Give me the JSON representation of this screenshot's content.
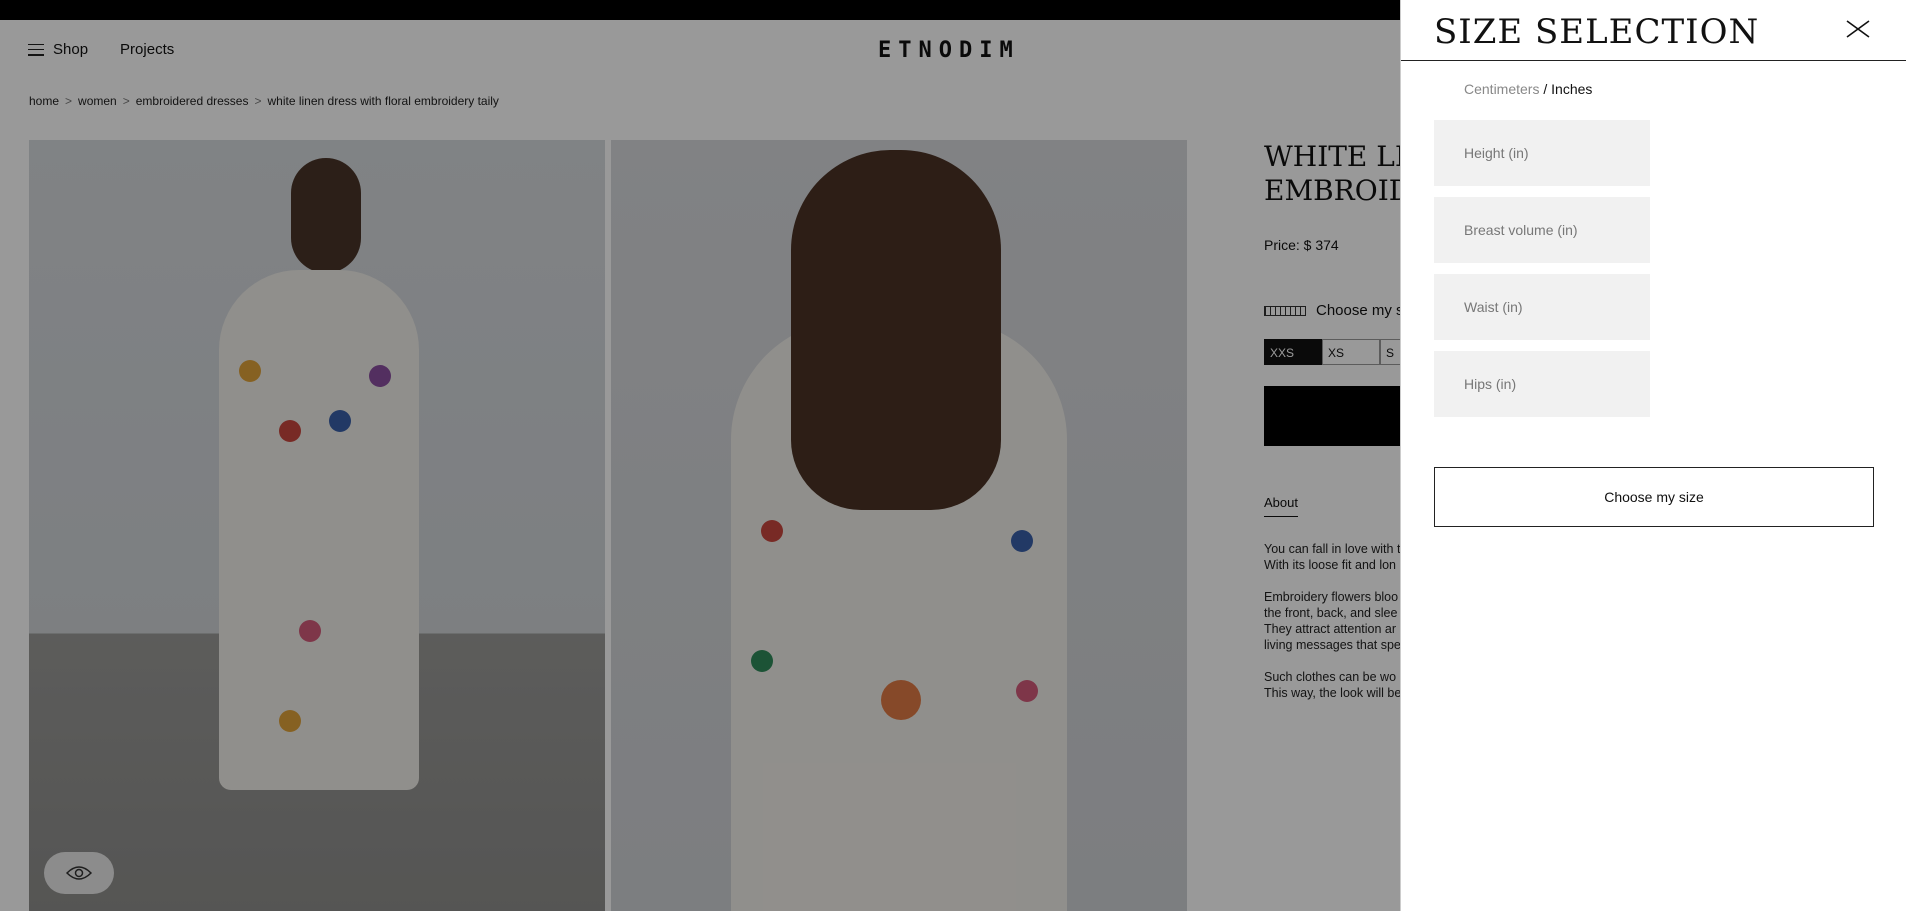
{
  "header": {
    "nav": {
      "shop_label": "Shop",
      "projects_label": "Projects"
    },
    "logo_text": "ETNODIM"
  },
  "breadcrumb": [
    "home",
    "women",
    "embroidered dresses",
    "white linen dress with floral embroidery taily"
  ],
  "breadcrumb_separator": ">",
  "product": {
    "title_line1": "WHITE LIN",
    "title_line2": "EMBROIDE",
    "price": "Price: $ 374",
    "choose_size_label": "Choose my si",
    "sizes": [
      "XXS",
      "XS",
      "S"
    ],
    "selected_size": "XXS",
    "about_tab": "About",
    "description": [
      "You can fall in love with t",
      "With its loose fit and lon",
      "Embroidery flowers bloo",
      "the front, back, and slee",
      "They attract attention ar",
      "living messages that spe",
      "Such clothes can be wo",
      "This way, the look will be"
    ]
  },
  "size_panel": {
    "title": "SIZE SELECTION",
    "units_inactive": "Centimeters",
    "units_separator": " / ",
    "units_active": "Inches",
    "fields": [
      {
        "placeholder": "Height (in)"
      },
      {
        "placeholder": "Breast volume (in)"
      },
      {
        "placeholder": "Waist (in)"
      },
      {
        "placeholder": "Hips (in)"
      }
    ],
    "submit_label": "Choose my size"
  },
  "colors": {
    "panel_bg": "#ffffff",
    "overlay": "rgba(0,0,0,0.4)",
    "field_bg": "#f1f1f1",
    "accent": "#111111"
  },
  "icons": [
    "menu-icon",
    "close-icon",
    "eye-icon",
    "ruler-icon"
  ]
}
